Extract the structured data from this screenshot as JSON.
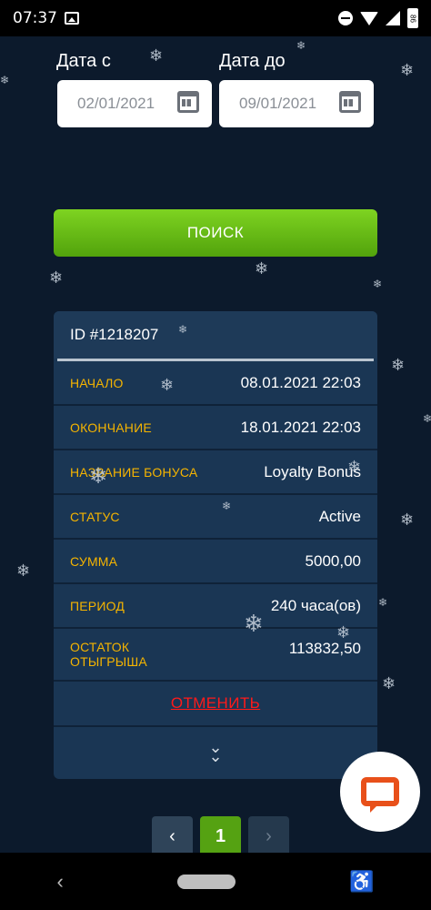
{
  "status_bar": {
    "time": "07:37",
    "battery": "86"
  },
  "filters": {
    "date_from_label": "Дата с",
    "date_from_value": "02/01/2021",
    "date_to_label": "Дата до",
    "date_to_value": "09/01/2021"
  },
  "search_button": "ПОИСК",
  "bonus_card": {
    "id": "ID #1218207",
    "rows": [
      {
        "key": "НАЧАЛО",
        "value": "08.01.2021 22:03"
      },
      {
        "key": "ОКОНЧАНИЕ",
        "value": "18.01.2021 22:03"
      },
      {
        "key": "НАЗВАНИЕ БОНУСА",
        "value": "Loyalty Bonus"
      },
      {
        "key": "СТАТУС",
        "value": "Active"
      },
      {
        "key": "СУММА",
        "value": "5000,00"
      },
      {
        "key": "ПЕРИОД",
        "value": "240 часа(ов)"
      },
      {
        "key_line1": "ОСТАТОК",
        "key_line2": "ОТЫГРЫША",
        "value": "113832,50"
      }
    ],
    "cancel": "ОТМЕНИТЬ"
  },
  "pagination": {
    "prev": "‹",
    "current": "1",
    "next": "›"
  },
  "icons": {
    "calendar": "calendar-icon",
    "expand": "double-chevron-down-icon",
    "chat": "chat-bubble-icon",
    "snowflake": "snowflake-icon"
  },
  "colors": {
    "accent_green": "#55a212",
    "label_orange": "#f5b400",
    "cancel_red": "#ff1a1a",
    "card_bg": "#1a3654"
  }
}
